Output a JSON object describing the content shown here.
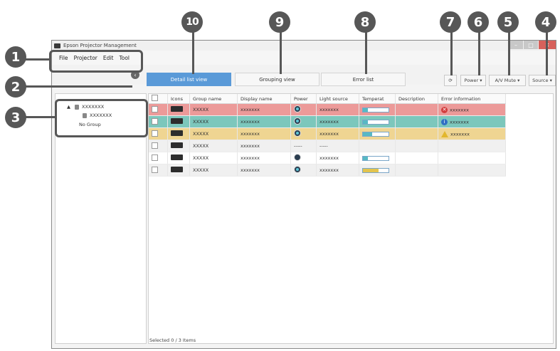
{
  "window": {
    "title": "Epson Projector Management"
  },
  "menu": [
    "File",
    "Projector",
    "Edit",
    "Tool"
  ],
  "tabs": {
    "detail": "Detail list view",
    "grouping": "Grouping view",
    "error": "Error list"
  },
  "toolbar": {
    "power": "Power ▾",
    "av_mute": "A/V Mute ▾",
    "source": "Source ▾"
  },
  "tree": {
    "group": "XXXXXXX",
    "child": "XXXXXXX",
    "no_group": "No Group"
  },
  "columns": [
    "Icons",
    "Group name",
    "Display name",
    "Power",
    "Light source",
    "Temperat",
    "Description",
    "Error information"
  ],
  "rows": [
    {
      "group": "XXXXX",
      "display": "xxxxxxx",
      "power": "on",
      "light": "xxxxxxx",
      "temp": 0.2,
      "error_icon": "error-icon",
      "error": "xxxxxxx"
    },
    {
      "group": "XXXXX",
      "display": "xxxxxxx",
      "power": "on",
      "light": "xxxxxxx",
      "temp": 0.2,
      "error_icon": "info-icon",
      "error": "xxxxxxx"
    },
    {
      "group": "XXXXX",
      "display": "xxxxxxx",
      "power": "on",
      "light": "xxxxxxx",
      "temp": 0.35,
      "error_icon": "warning-icon",
      "error": "xxxxxxx"
    },
    {
      "group": "XXXXX",
      "display": "xxxxxxx",
      "power": "-----",
      "light": "-----",
      "temp": 0,
      "error_icon": "",
      "error": ""
    },
    {
      "group": "XXXXX",
      "display": "xxxxxxx",
      "power": "off",
      "light": "xxxxxxx",
      "temp": 0.2,
      "error_icon": "",
      "error": ""
    },
    {
      "group": "XXXXX",
      "display": "xxxxxxx",
      "power": "on",
      "light": "xxxxxxx",
      "temp": 0.6,
      "error_icon": "",
      "error": ""
    }
  ],
  "status": {
    "text": "Selected  0 / 3  Items"
  },
  "callouts": [
    "1",
    "2",
    "3",
    "4",
    "5",
    "6",
    "7",
    "8",
    "9",
    "10"
  ],
  "colors": {
    "active_tab": "#5a9ad8",
    "error_row": "#ec9a99",
    "info_row": "#7cc7bc",
    "warning_row": "#efd592"
  }
}
